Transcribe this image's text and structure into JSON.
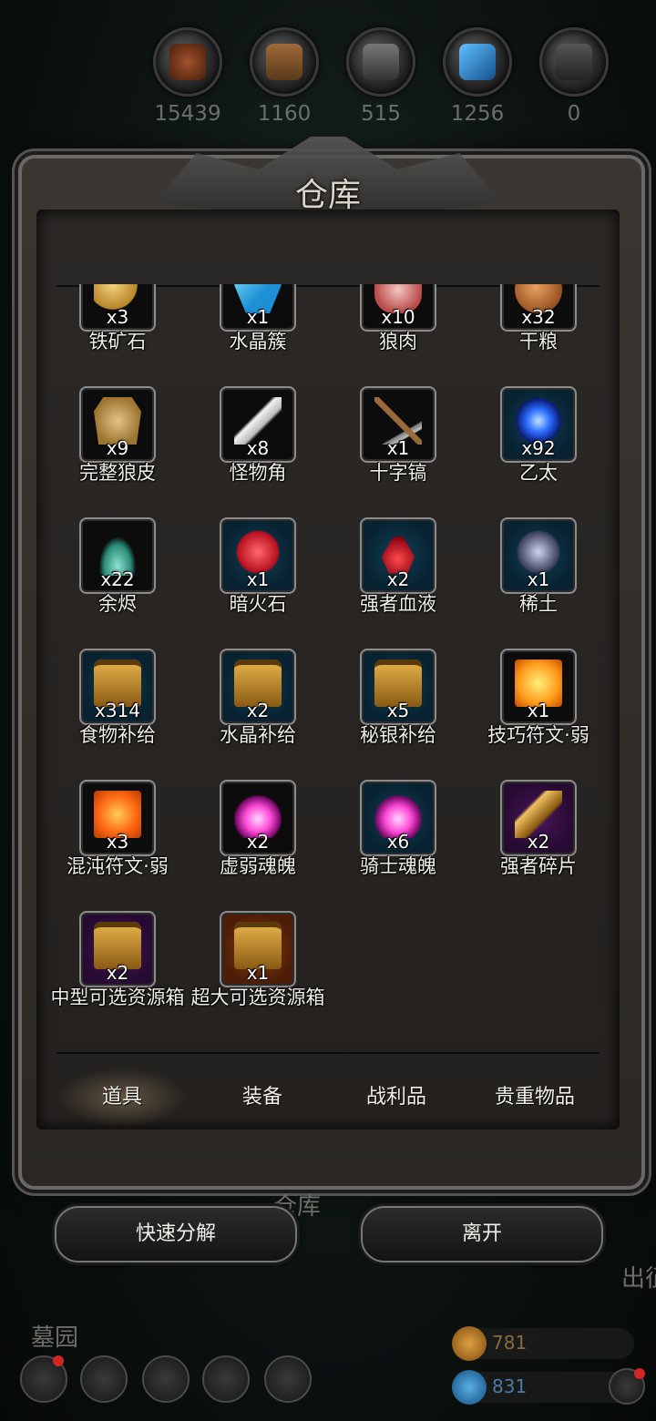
{
  "resources": [
    {
      "id": "food",
      "value": "15439",
      "color": "#7a3a1a"
    },
    {
      "id": "wood",
      "value": "1160",
      "color": "#7a5230"
    },
    {
      "id": "iron",
      "value": "515",
      "color": "#555555"
    },
    {
      "id": "crystal",
      "value": "1256",
      "color": "#2a86c8"
    },
    {
      "id": "mithril",
      "value": "0",
      "color": "#3a3a3a"
    }
  ],
  "warehouse": {
    "title": "仓库",
    "items": [
      {
        "name": "铁矿石",
        "qty": "x3",
        "frame": "",
        "art": "a-ore"
      },
      {
        "name": "水晶簇",
        "qty": "x1",
        "frame": "",
        "art": "a-crystal"
      },
      {
        "name": "狼肉",
        "qty": "x10",
        "frame": "",
        "art": "a-meat"
      },
      {
        "name": "干粮",
        "qty": "x32",
        "frame": "",
        "art": "a-bread"
      },
      {
        "name": "完整狼皮",
        "qty": "x9",
        "frame": "",
        "art": "a-pelt"
      },
      {
        "name": "怪物角",
        "qty": "x8",
        "frame": "",
        "art": "a-horn"
      },
      {
        "name": "十字镐",
        "qty": "x1",
        "frame": "",
        "art": "a-pick"
      },
      {
        "name": "乙太",
        "qty": "x92",
        "frame": "blue",
        "art": "a-ether"
      },
      {
        "name": "余烬",
        "qty": "x22",
        "frame": "",
        "art": "a-ember"
      },
      {
        "name": "暗火石",
        "qty": "x1",
        "frame": "blue",
        "art": "a-darkfire"
      },
      {
        "name": "强者血液",
        "qty": "x2",
        "frame": "blue",
        "art": "a-blood"
      },
      {
        "name": "稀土",
        "qty": "x1",
        "frame": "blue",
        "art": "a-rare"
      },
      {
        "name": "食物补给",
        "qty": "x314",
        "frame": "blue",
        "art": "a-chest"
      },
      {
        "name": "水晶补给",
        "qty": "x2",
        "frame": "blue",
        "art": "a-chest"
      },
      {
        "name": "秘银补给",
        "qty": "x5",
        "frame": "blue",
        "art": "a-chest"
      },
      {
        "name": "技巧符文·弱",
        "qty": "x1",
        "frame": "",
        "art": "a-rune-y"
      },
      {
        "name": "混沌符文·弱",
        "qty": "x3",
        "frame": "",
        "art": "a-rune-o"
      },
      {
        "name": "虚弱魂魄",
        "qty": "x2",
        "frame": "",
        "art": "a-soul"
      },
      {
        "name": "骑士魂魄",
        "qty": "x6",
        "frame": "blue",
        "art": "a-soul"
      },
      {
        "name": "强者碎片",
        "qty": "x2",
        "frame": "purple",
        "art": "a-shard"
      },
      {
        "name": "中型可选资源箱",
        "qty": "x2",
        "frame": "purple",
        "art": "a-chest"
      },
      {
        "name": "超大可选资源箱",
        "qty": "x1",
        "frame": "orange",
        "art": "a-chest"
      }
    ],
    "tabs": [
      {
        "label": "道具",
        "active": true
      },
      {
        "label": "装备",
        "active": false
      },
      {
        "label": "战利品",
        "active": false
      },
      {
        "label": "贵重物品",
        "active": false
      }
    ]
  },
  "buttons": {
    "decompose": "快速分解",
    "leave": "离开"
  },
  "background": {
    "label_warehouse": "仓库",
    "label_graveyard": "墓园",
    "label_depart": "出征"
  },
  "currency": {
    "gold": "781",
    "gem": "831"
  }
}
